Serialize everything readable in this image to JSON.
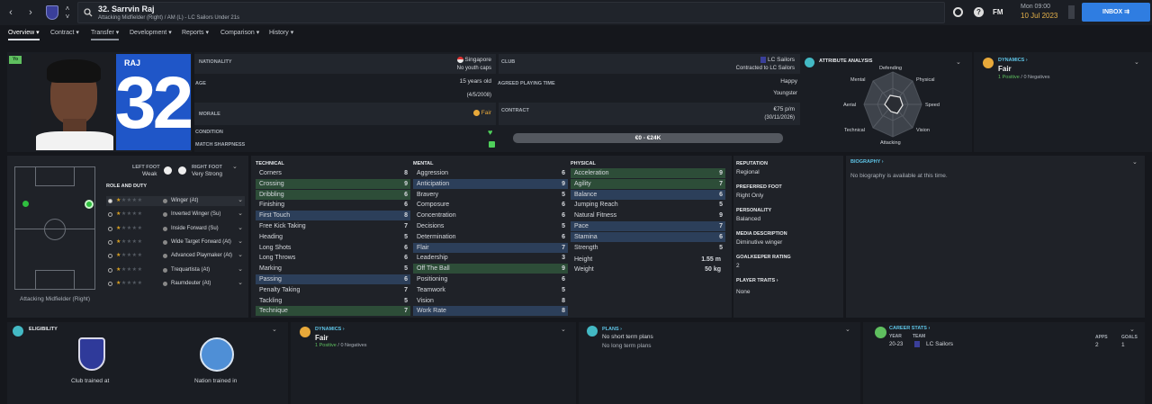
{
  "header": {
    "player_name": "32. Sarrvin Raj",
    "subtitle": "Attacking Midfielder (Right) / AM (L) - LC Sailors Under 21s",
    "date_day": "Mon 09:00",
    "date": "10 Jul 2023",
    "fm_label": "FM",
    "inbox_label": "INBOX"
  },
  "tabs": [
    "Overview",
    "Contract",
    "Transfer",
    "Development",
    "Reports",
    "Comparison",
    "History"
  ],
  "portrait": {
    "shirt_name": "RAJ",
    "shirt_number": "32",
    "badge": "Yo"
  },
  "info": {
    "nationality_label": "NATIONALITY",
    "nationality": "Singapore",
    "youth_caps": "No youth caps",
    "age_label": "AGE",
    "age": "15 years old",
    "dob": "(4/5/2008)",
    "morale_label": "MORALE",
    "morale": "Fair",
    "condition_label": "CONDITION",
    "sharpness_label": "MATCH SHARPNESS",
    "club_label": "CLUB",
    "club": "LC Sailors",
    "contracted": "Contracted to LC Sailors",
    "playing_time_label": "AGREED PLAYING TIME",
    "playing_time": "Happy",
    "playing_time_sub": "Youngster",
    "contract_label": "CONTRACT",
    "wage": "€75 p/m",
    "expiry": "(30/11/2026)",
    "value": "€0 - €24K"
  },
  "attr_analysis": {
    "title": "ATTRIBUTE ANALYSIS",
    "axes": [
      "Defending",
      "Physical",
      "Speed",
      "Vision",
      "Attacking",
      "Technical",
      "Aerial",
      "Mental"
    ]
  },
  "dynamics_top": {
    "title": "DYNAMICS",
    "value": "Fair",
    "positives": "1 Positive",
    "sep": "/",
    "negatives": "0 Negatives"
  },
  "feet": {
    "left_label": "LEFT FOOT",
    "left": "Weak",
    "right_label": "RIGHT FOOT",
    "right": "Very Strong"
  },
  "role_title": "ROLE AND DUTY",
  "roles": [
    {
      "name": "Winger (At)",
      "stars": 1,
      "selected": true
    },
    {
      "name": "Inverted Winger (Su)",
      "stars": 1,
      "selected": false
    },
    {
      "name": "Inside Forward (Su)",
      "stars": 1,
      "selected": false
    },
    {
      "name": "Wide Target Forward (At)",
      "stars": 1,
      "selected": false
    },
    {
      "name": "Advanced Playmaker (At)",
      "stars": 1,
      "selected": false
    },
    {
      "name": "Trequartista (At)",
      "stars": 1,
      "selected": false
    },
    {
      "name": "Raumdeuter (At)",
      "stars": 1,
      "selected": false
    }
  ],
  "position_label": "Attacking Midfielder (Right)",
  "technical": {
    "title": "TECHNICAL",
    "rows": [
      {
        "name": "Corners",
        "value": "8",
        "hl": ""
      },
      {
        "name": "Crossing",
        "value": "9",
        "hl": "g"
      },
      {
        "name": "Dribbling",
        "value": "6",
        "hl": "g"
      },
      {
        "name": "Finishing",
        "value": "6",
        "hl": ""
      },
      {
        "name": "First Touch",
        "value": "8",
        "hl": "b"
      },
      {
        "name": "Free Kick Taking",
        "value": "7",
        "hl": ""
      },
      {
        "name": "Heading",
        "value": "5",
        "hl": ""
      },
      {
        "name": "Long Shots",
        "value": "6",
        "hl": ""
      },
      {
        "name": "Long Throws",
        "value": "6",
        "hl": ""
      },
      {
        "name": "Marking",
        "value": "5",
        "hl": ""
      },
      {
        "name": "Passing",
        "value": "6",
        "hl": "b"
      },
      {
        "name": "Penalty Taking",
        "value": "7",
        "hl": ""
      },
      {
        "name": "Tackling",
        "value": "5",
        "hl": ""
      },
      {
        "name": "Technique",
        "value": "7",
        "hl": "g"
      }
    ]
  },
  "mental": {
    "title": "MENTAL",
    "rows": [
      {
        "name": "Aggression",
        "value": "6",
        "hl": ""
      },
      {
        "name": "Anticipation",
        "value": "9",
        "hl": "b"
      },
      {
        "name": "Bravery",
        "value": "5",
        "hl": ""
      },
      {
        "name": "Composure",
        "value": "6",
        "hl": ""
      },
      {
        "name": "Concentration",
        "value": "6",
        "hl": ""
      },
      {
        "name": "Decisions",
        "value": "5",
        "hl": ""
      },
      {
        "name": "Determination",
        "value": "6",
        "hl": ""
      },
      {
        "name": "Flair",
        "value": "7",
        "hl": "b"
      },
      {
        "name": "Leadership",
        "value": "3",
        "hl": ""
      },
      {
        "name": "Off The Ball",
        "value": "9",
        "hl": "g"
      },
      {
        "name": "Positioning",
        "value": "6",
        "hl": ""
      },
      {
        "name": "Teamwork",
        "value": "5",
        "hl": ""
      },
      {
        "name": "Vision",
        "value": "8",
        "hl": ""
      },
      {
        "name": "Work Rate",
        "value": "8",
        "hl": "b"
      }
    ]
  },
  "physical": {
    "title": "PHYSICAL",
    "rows": [
      {
        "name": "Acceleration",
        "value": "9",
        "hl": "g"
      },
      {
        "name": "Agility",
        "value": "7",
        "hl": "g"
      },
      {
        "name": "Balance",
        "value": "6",
        "hl": "b"
      },
      {
        "name": "Jumping Reach",
        "value": "5",
        "hl": ""
      },
      {
        "name": "Natural Fitness",
        "value": "9",
        "hl": ""
      },
      {
        "name": "Pace",
        "value": "7",
        "hl": "b"
      },
      {
        "name": "Stamina",
        "value": "6",
        "hl": "b"
      },
      {
        "name": "Strength",
        "value": "5",
        "hl": ""
      }
    ],
    "height_label": "Height",
    "height": "1.55 m",
    "weight_label": "Weight",
    "weight": "50 kg"
  },
  "profile": {
    "reputation_label": "REPUTATION",
    "reputation": "Regional",
    "foot_label": "PREFERRED FOOT",
    "foot": "Right Only",
    "personality_label": "PERSONALITY",
    "personality": "Balanced",
    "media_label": "MEDIA DESCRIPTION",
    "media": "Diminutive winger",
    "gk_label": "GOALKEEPER RATING",
    "gk": "2",
    "traits_label": "PLAYER TRAITS",
    "traits": "None"
  },
  "biography": {
    "title": "BIOGRAPHY",
    "text": "No biography is available at this time."
  },
  "eligibility": {
    "title": "ELIGIBILITY",
    "club_label": "Club trained at",
    "nation_label": "Nation trained in"
  },
  "dynamics_bottom": {
    "title": "DYNAMICS",
    "value": "Fair",
    "positives": "1 Positive",
    "sep": "/",
    "negatives": "0 Negatives"
  },
  "plans": {
    "title": "PLANS",
    "short": "No short term plans",
    "long": "No long term plans"
  },
  "career": {
    "title": "CAREER STATS",
    "year_label": "YEAR",
    "team_label": "TEAM",
    "apps_label": "APPS",
    "goals_label": "GOALS",
    "year": "20-23",
    "team": "LC Sailors",
    "apps": "2",
    "goals": "1"
  },
  "colors": {
    "accent": "#2f7de1",
    "green_hl": "#2d4d38",
    "blue_hl": "#2c3f5a",
    "star": "#d9a022"
  }
}
